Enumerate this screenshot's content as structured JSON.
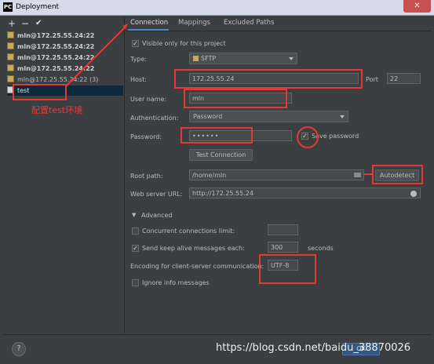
{
  "window": {
    "title": "Deployment",
    "app_icon": "PC",
    "close_glyph": "✕"
  },
  "sidebar": {
    "toolbar": {
      "add": "+",
      "remove": "−",
      "check": "✔"
    },
    "servers": [
      {
        "label": "mln@172.25.55.24:22",
        "bold": true
      },
      {
        "label": "mln@172.25.55.24:22",
        "bold": true
      },
      {
        "label": "mln@172.25.55.24:22",
        "bold": true
      },
      {
        "label": "mln@172.25.55.24:22",
        "bold": true
      },
      {
        "label": "mln@172.25.55.24:22 (3)",
        "bold": false
      },
      {
        "label": "test",
        "bold": false
      }
    ]
  },
  "annotation": {
    "configure_test": "配置test环境"
  },
  "tabs": [
    {
      "label": "Connection"
    },
    {
      "label": "Mappings"
    },
    {
      "label": "Excluded Paths"
    }
  ],
  "connection": {
    "visible_only": "Visible only for this project",
    "type_label": "Type:",
    "type_value": "SFTP",
    "host_label": "Host:",
    "host_value": "172.25.55.24",
    "port_label": "Port",
    "port_value": "22",
    "user_label": "User name:",
    "user_value": "mln",
    "auth_label": "Authentication:",
    "auth_value": "Password",
    "password_label": "Password:",
    "password_value": "••••••",
    "save_password": "Save password",
    "test_connection": "Test Connection",
    "root_label": "Root path:",
    "root_value": "/home/mln",
    "autodetect": "Autodetect",
    "web_label": "Web server URL:",
    "web_value": "http://172.25.55.24"
  },
  "advanced": {
    "header": "Advanced",
    "concurrent_label": "Concurrent connections limit:",
    "concurrent_value": "",
    "keepalive_label": "Send keep alive messages each:",
    "keepalive_value": "300",
    "keepalive_unit": "seconds",
    "encoding_label": "Encoding for client-server communication:",
    "encoding_value": "UTF-8",
    "ignore_label": "Ignore info messages"
  },
  "footer": {
    "help": "?",
    "ok": "OK",
    "watermark": "https://blog.csdn.net/baidu_38870026"
  },
  "colors": {
    "background": "#3c3f41",
    "annotation_red": "#e53935",
    "selection": "#0d293e"
  }
}
